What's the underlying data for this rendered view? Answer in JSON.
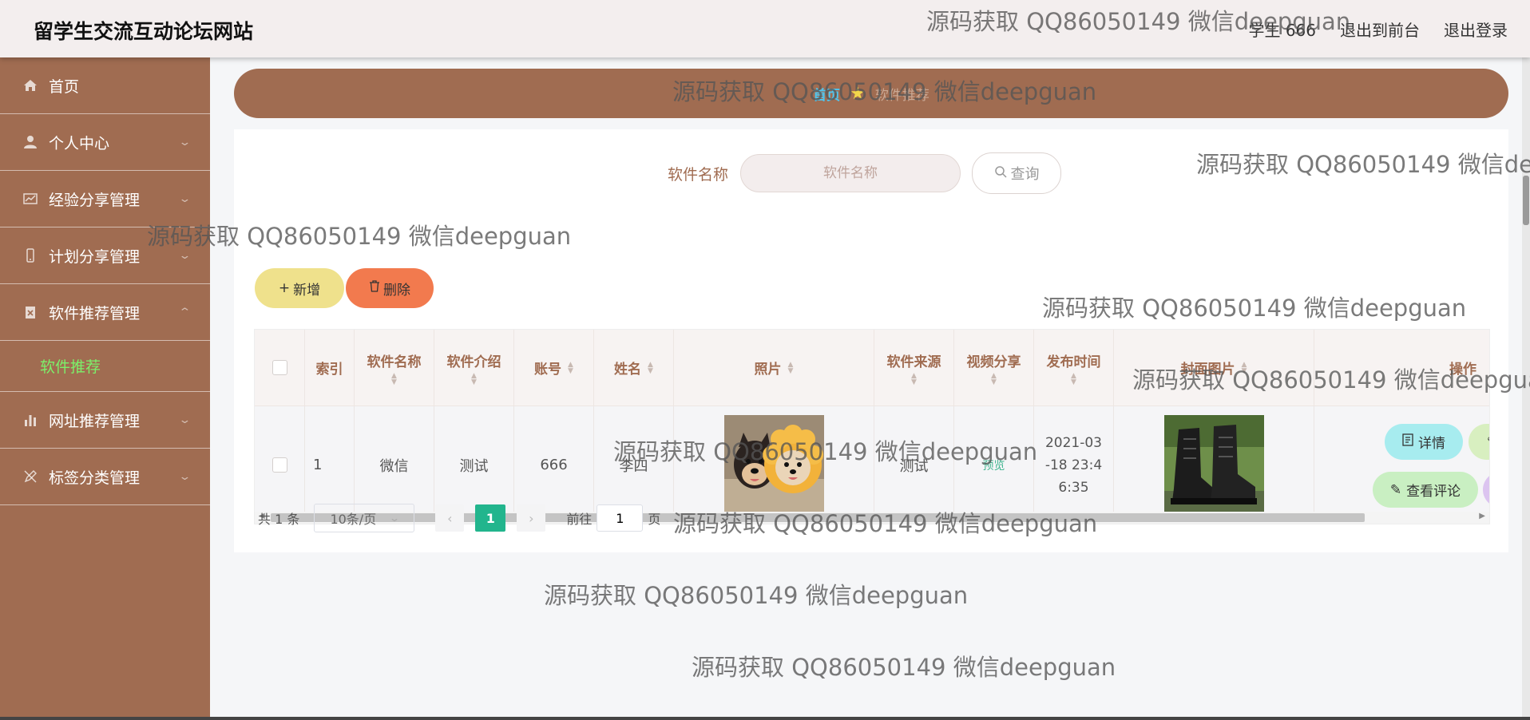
{
  "header": {
    "site_title": "留学生交流互动论坛网站",
    "user_label": "学生 666",
    "back_to_front": "退出到前台",
    "logout": "退出登录"
  },
  "sidebar": {
    "items": [
      {
        "label": "首页",
        "icon": "home-icon"
      },
      {
        "label": "个人中心",
        "icon": "user-icon"
      },
      {
        "label": "经验分享管理",
        "icon": "chart-icon"
      },
      {
        "label": "计划分享管理",
        "icon": "phone-icon"
      },
      {
        "label": "软件推荐管理",
        "icon": "delete-box-icon"
      },
      {
        "label": "网址推荐管理",
        "icon": "bar-chart-icon"
      },
      {
        "label": "标签分类管理",
        "icon": "edit-off-icon"
      }
    ],
    "sub_item": "软件推荐",
    "active_color": "#7cf06a"
  },
  "breadcrumb": {
    "home": "首页",
    "current": "软件推荐"
  },
  "search": {
    "label": "软件名称",
    "placeholder": "软件名称",
    "query_button": "查询"
  },
  "actions": {
    "add": "新增",
    "delete": "删除"
  },
  "table": {
    "headers": [
      "索引",
      "软件名称",
      "软件介绍",
      "账号",
      "姓名",
      "照片",
      "软件来源",
      "视频分享",
      "发布时间",
      "封面图片",
      "操作"
    ],
    "rows": [
      {
        "index": "1",
        "name": "微信",
        "intro": "测试",
        "account": "666",
        "real_name": "李四",
        "photo": "dogs-photo",
        "source": "测试",
        "video": "预览",
        "time": "2021-03-18 23:46:35",
        "time_lines": [
          "2021-03",
          "-18 23:4",
          "6:35"
        ],
        "cover": "boots-photo",
        "ops": [
          "详情",
          "查看评论"
        ]
      }
    ]
  },
  "pagination": {
    "total": "共 1 条",
    "page_size": "10条/页",
    "current_page": "1",
    "goto_prefix": "前往",
    "goto_value": "1",
    "goto_suffix": "页"
  },
  "watermark": "源码获取 QQ86050149 微信deepguan",
  "colors": {
    "brand_brown": "#a06c51",
    "add_button": "#efe18c",
    "delete_button": "#f27a4e",
    "page_active": "#22b58d"
  }
}
